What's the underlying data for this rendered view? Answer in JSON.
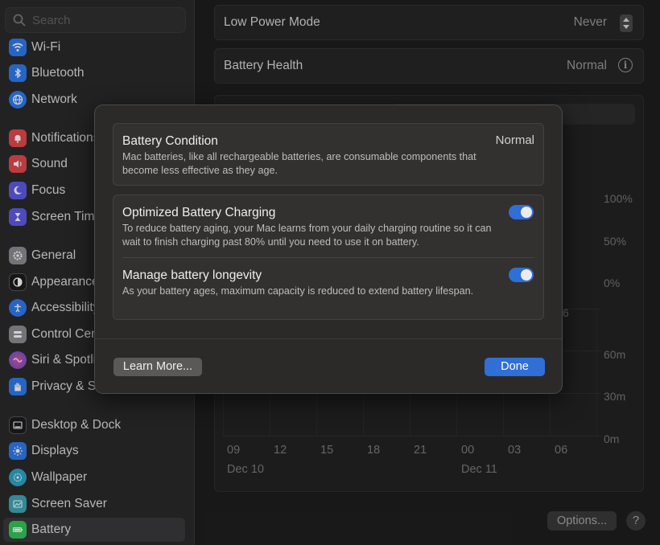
{
  "sidebar": {
    "search_placeholder": "Search",
    "items": [
      {
        "label": "Wi-Fi",
        "icon": "wifi-icon",
        "color": "#2f7cf0"
      },
      {
        "label": "Bluetooth",
        "icon": "bluetooth-icon",
        "color": "#2f7cf0"
      },
      {
        "label": "Network",
        "icon": "network-icon",
        "color": "#2f7cf0"
      },
      {
        "label": "Notifications",
        "icon": "bell-icon",
        "color": "#e5484d"
      },
      {
        "label": "Sound",
        "icon": "speaker-icon",
        "color": "#e5484d"
      },
      {
        "label": "Focus",
        "icon": "moon-icon",
        "color": "#5e5ce6"
      },
      {
        "label": "Screen Time",
        "icon": "hourglass-icon",
        "color": "#5e5ce6"
      },
      {
        "label": "General",
        "icon": "gear-icon",
        "color": "#8e8e93"
      },
      {
        "label": "Appearance",
        "icon": "appearance-icon",
        "color": "#1c1c1e"
      },
      {
        "label": "Accessibility",
        "icon": "accessibility-icon",
        "color": "#2f7cf0"
      },
      {
        "label": "Control Centre",
        "icon": "control-centre-icon",
        "color": "#8e8e93"
      },
      {
        "label": "Siri & Spotlight",
        "icon": "siri-icon",
        "color": "#7a3fd0"
      },
      {
        "label": "Privacy & Security",
        "icon": "hand-icon",
        "color": "#2f7cf0"
      },
      {
        "label": "Desktop & Dock",
        "icon": "dock-icon",
        "color": "#1c1c1e"
      },
      {
        "label": "Displays",
        "icon": "sun-icon",
        "color": "#2f7cf0"
      },
      {
        "label": "Wallpaper",
        "icon": "wallpaper-icon",
        "color": "#2ea6c7"
      },
      {
        "label": "Screen Saver",
        "icon": "screensaver-icon",
        "color": "#3fa8b8"
      },
      {
        "label": "Battery",
        "icon": "battery-icon",
        "color": "#34c759"
      }
    ]
  },
  "main": {
    "low_power_label": "Low Power Mode",
    "low_power_value": "Never",
    "battery_health_label": "Battery Health",
    "battery_health_value": "Normal",
    "segment_partial": "s",
    "level_axis": [
      "100%",
      "50%",
      "0%"
    ],
    "usage_axis": [
      "60m",
      "30m",
      "0m"
    ],
    "partial_axis_label": "6",
    "x_ticks": [
      "09",
      "12",
      "15",
      "18",
      "21",
      "00",
      "03",
      "06"
    ],
    "x_dates": [
      "Dec 10",
      "Dec 11"
    ],
    "options_label": "Options...",
    "help_label": "?"
  },
  "modal": {
    "condition_title": "Battery Condition",
    "condition_value": "Normal",
    "condition_desc": "Mac batteries, like all rechargeable batteries, are consumable components that become less effective as they age.",
    "optimized_title": "Optimized Battery Charging",
    "optimized_desc": "To reduce battery aging, your Mac learns from your daily charging routine so it can wait to finish charging past 80% until you need to use it on battery.",
    "optimized_on": true,
    "longevity_title": "Manage battery longevity",
    "longevity_desc": "As your battery ages, maximum capacity is reduced to extend battery lifespan.",
    "longevity_on": true,
    "learn_more": "Learn More...",
    "done": "Done"
  },
  "colors": {
    "accent": "#2f6fd6"
  }
}
